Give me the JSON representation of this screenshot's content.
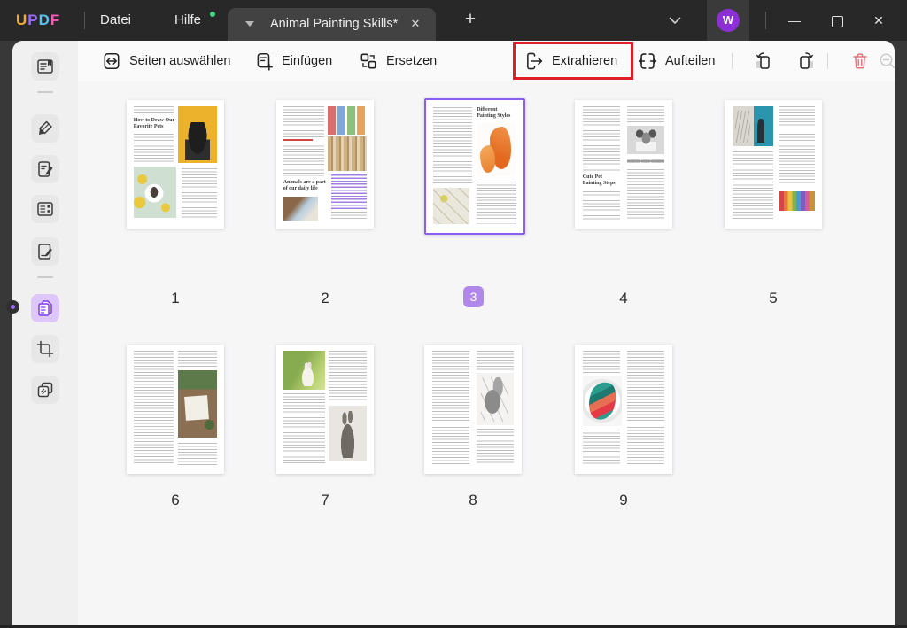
{
  "titlebar": {
    "logo_letters": [
      "U",
      "P",
      "D",
      "F"
    ],
    "menu_datei": "Datei",
    "menu_hilfe": "Hilfe",
    "tab_title": "Animal Painting Skills*",
    "new_tab_glyph": "+",
    "tab_close_glyph": "✕",
    "minimize_glyph": "—",
    "close_glyph": "✕",
    "avatar_initial": "W",
    "icons": [
      "chevron-down-icon",
      "tab-close-icon",
      "new-tab-icon",
      "minimize-icon",
      "maximize-icon",
      "close-icon",
      "avatar"
    ]
  },
  "toolbar": {
    "select_pages": "Seiten auswählen",
    "insert": "Einfügen",
    "replace": "Ersetzen",
    "extract": "Extrahieren",
    "split": "Aufteilen",
    "icons": [
      "select-pages-icon",
      "insert-icon",
      "replace-icon",
      "extract-icon",
      "split-icon",
      "rotate-left-icon",
      "rotate-right-icon",
      "trash-icon",
      "zoom-out-icon",
      "zoom-in-icon"
    ],
    "highlight_color": "#e01e25"
  },
  "sidebar": {
    "icons": [
      "reader-icon",
      "highlighter-icon",
      "edit-icon",
      "form-icon",
      "sign-icon",
      "organize-pages-icon",
      "crop-icon",
      "stamp-icon"
    ],
    "active_item": "organize-pages-icon",
    "active_bg": "#dcc7f8"
  },
  "pages": [
    {
      "number": "1",
      "heading": "How to Draw Our Favorite Pets",
      "selected": false
    },
    {
      "number": "2",
      "heading": "Animals are a part of our daily life",
      "selected": false
    },
    {
      "number": "3",
      "heading": "Different Painting Styles",
      "selected": true
    },
    {
      "number": "4",
      "heading": "Cute Pet Painting Steps",
      "selected": false
    },
    {
      "number": "5",
      "selected": false
    },
    {
      "number": "6",
      "selected": false
    },
    {
      "number": "7",
      "selected": false
    },
    {
      "number": "8",
      "selected": false
    },
    {
      "number": "9",
      "selected": false
    }
  ],
  "colors": {
    "title_bar": "#282828",
    "selection_border": "#8b5cf6",
    "badge_bg": "#b088ea",
    "red_highlight": "#e01e25",
    "accent_purple": "#7c3aed"
  }
}
